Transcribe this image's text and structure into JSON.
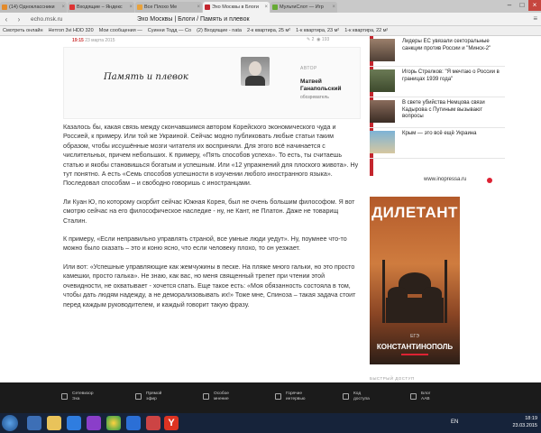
{
  "browser": {
    "tabs": [
      {
        "label": "(14) Одноклассники",
        "active": false
      },
      {
        "label": "Входящие – Яндекс",
        "active": false
      },
      {
        "label": "Все Плохо Ме",
        "active": false
      },
      {
        "label": "Эхо Москвы в Блоги",
        "active": true
      },
      {
        "label": "МультиСлот — Игр",
        "active": false
      }
    ],
    "url": "echo.msk.ru",
    "page_title": "Эхо Москвы | Блоги / Память и плевок",
    "bookmarks": [
      "Смотреть онлайн",
      "Heтrоп 3vi HDD 320",
      "Мои сообщения —",
      "Суинни Тодд — Со",
      "(2) Входящие - nata",
      "2-к квартира, 25 м²",
      "1-к квартира, 23 м²",
      "1-к квартира, 22 м²"
    ]
  },
  "post": {
    "time": "19:15",
    "date": "23 марта 2015",
    "comments": "2",
    "views": "193",
    "title": "Память и плевок",
    "author_label": "АВТОР",
    "author_name_line1": "Матвей",
    "author_name_line2": "Ганапольский",
    "author_role": "обозреватель"
  },
  "article": {
    "paragraphs": [
      "Казалось бы, какая связь между скончавшимся автором Корейского экономического чуда и Россией, к примеру. Или той же Украиной. Сейчас модно публиковать любые статьи таким образом, чтобы иссушённые мозги читателя их восприняли. Для этого всё начинается с числительных, причем небольших. К примеру, «Пять способов успеха». То есть, ты считаешь статью и якобы становишься богатым и успешным. Или «12 упражнений для плоского живота». Ну тут понятно. А есть «Семь способов успешности в изучении любого иностранного языка». Последовал способам – и свободно говоришь с иностранцами.",
      "Ли Куан Ю, по которому скорбит сейчас Южная Корея, был не очень большим философом. Я вот смотрю сейчас на его философическое наследие - ну, не Кант, не Платон. Даже не товарищ Сталин.",
      "К примеру, «Если неправильно управлять страной, все умные люди уедут». Ну, поумнее что-то можно было сказать – это и коню ясно, что если человеку плохо, то он уезжает.",
      "Или вот: «Успешные управляющие как жемчужины в песке. На пляже много гальки, но это просто камешки, просто галька». Не знаю, как вас, но меня священный трепет при чтении этой очевидности, не охватывает - хочется спать. Еще такое есть: «Моя обязанность состояла в том, чтобы дать людям надежду, а не деморализовывать их!» Тоже мне, Спиноза – такая задача стоит перед каждым руководителем, и каждый говорит такую фразу."
    ]
  },
  "news": [
    {
      "text": "Лидеры ЕС увязали секторальные санкции против России и \"Минск-2\""
    },
    {
      "text": "Игорь Стрелков: \"Я мечтаю о России в границах 1939 года\""
    },
    {
      "text": "В свете убийства Немцова связи Кадырова с Путиным вызывают вопросы"
    },
    {
      "text": "Крым — это всё ещё Украина"
    }
  ],
  "inopressa": "www.inopressa.ru",
  "ad": {
    "title": "ДИЛЕТАНТ",
    "subtitle": "ЕГЭ",
    "bottom": "КОНСТАНТИНОПОЛЬ"
  },
  "quick_access": "БЫСТРЫЙ ДОСТУП",
  "sitebar": [
    {
      "label1": "Сетевизор",
      "label2": "Эха"
    },
    {
      "label1": "Прямой",
      "label2": "эфир"
    },
    {
      "label1": "Особое",
      "label2": "мнение"
    },
    {
      "label1": "Горячие",
      "label2": "интервью"
    },
    {
      "label1": "Код",
      "label2": "доступа"
    },
    {
      "label1": "Блог",
      "label2": "ААВ"
    }
  ],
  "taskbar": {
    "lang": "EN",
    "time": "18:19",
    "date": "23.03.2015"
  },
  "colors": {
    "accent_red": "#c4262e",
    "sitebar_bg": "#1b1b1b",
    "taskbar_bg": "#16233a"
  }
}
